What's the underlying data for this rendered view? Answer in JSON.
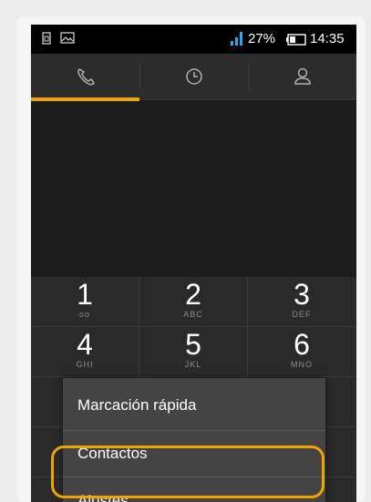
{
  "status_bar": {
    "battery_text": "27%",
    "time": "14:35",
    "icons": [
      "sim-card-icon",
      "image-icon",
      "signal-icon",
      "battery-icon"
    ]
  },
  "tabs": [
    {
      "name": "phone",
      "icon": "phone-icon",
      "active": true
    },
    {
      "name": "recent",
      "icon": "clock-icon",
      "active": false
    },
    {
      "name": "contacts",
      "icon": "person-icon",
      "active": false
    }
  ],
  "keypad": {
    "keys": [
      {
        "digit": "1",
        "sub": "oo"
      },
      {
        "digit": "2",
        "sub": "ABC"
      },
      {
        "digit": "3",
        "sub": "DEF"
      },
      {
        "digit": "4",
        "sub": "GHI"
      },
      {
        "digit": "5",
        "sub": "JKL"
      },
      {
        "digit": "6",
        "sub": "MNO"
      }
    ]
  },
  "menu": {
    "items": [
      "Marcación rápida",
      "Contactos",
      "Ajustes"
    ]
  },
  "colors": {
    "accent": "#f0a400",
    "menu_bg": "#444444",
    "keypad_bg": "#2a2a2a"
  }
}
